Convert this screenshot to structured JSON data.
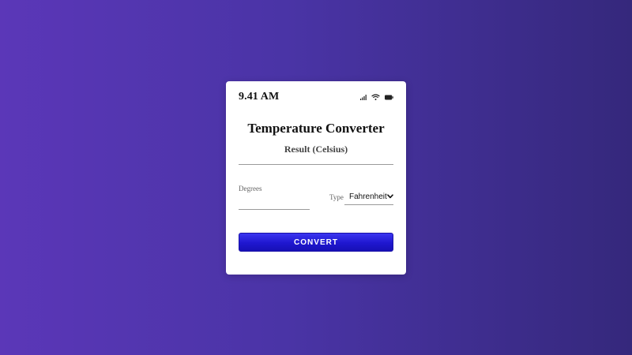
{
  "status_bar": {
    "time": "9.41 AM",
    "icons": [
      "signal-icon",
      "wifi-icon",
      "battery-icon"
    ]
  },
  "converter": {
    "title": "Temperature Converter",
    "result_label": "Result (Celsius)",
    "result_value": "",
    "degrees_label": "Degrees",
    "degrees_value": "",
    "type_label": "Type",
    "type_selected": "Fahrenheit",
    "convert_label": "CONVERT"
  },
  "colors": {
    "background_start": "#5b37b8",
    "background_end": "#35287c",
    "button": "#1f17cf",
    "card": "#ffffff"
  }
}
